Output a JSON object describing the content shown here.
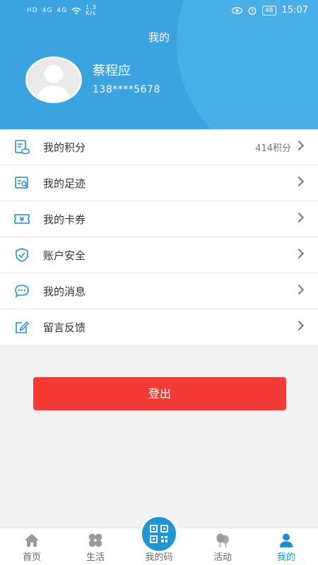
{
  "status_bar": {
    "left_icons": [
      "HD",
      "4G",
      "4G",
      "wifi"
    ],
    "net_speed": "1.3\nK/s",
    "battery": "48",
    "time": "15:07"
  },
  "header": {
    "title": "我的",
    "username": "蔡程应",
    "phone": "138****5678"
  },
  "menu": [
    {
      "label": "我的积分",
      "value": "414积分",
      "icon": "points-icon"
    },
    {
      "label": "我的足迹",
      "value": "",
      "icon": "footprint-icon"
    },
    {
      "label": "我的卡券",
      "value": "",
      "icon": "coupon-icon"
    },
    {
      "label": "账户安全",
      "value": "",
      "icon": "shield-icon"
    },
    {
      "label": "我的消息",
      "value": "",
      "icon": "message-icon"
    },
    {
      "label": "留言反馈",
      "value": "",
      "icon": "edit-icon"
    }
  ],
  "logout_label": "登出",
  "tabs": [
    {
      "label": "首页",
      "icon": "home-icon"
    },
    {
      "label": "生活",
      "icon": "life-icon"
    },
    {
      "label": "我的码",
      "icon": "qr-code-icon"
    },
    {
      "label": "活动",
      "icon": "activity-icon"
    },
    {
      "label": "我的",
      "icon": "user-icon",
      "active": true
    }
  ],
  "colors": {
    "header_bg": "#3aa3e0",
    "accent": "#1f8fc9",
    "logout_bg": "#f33b36"
  }
}
